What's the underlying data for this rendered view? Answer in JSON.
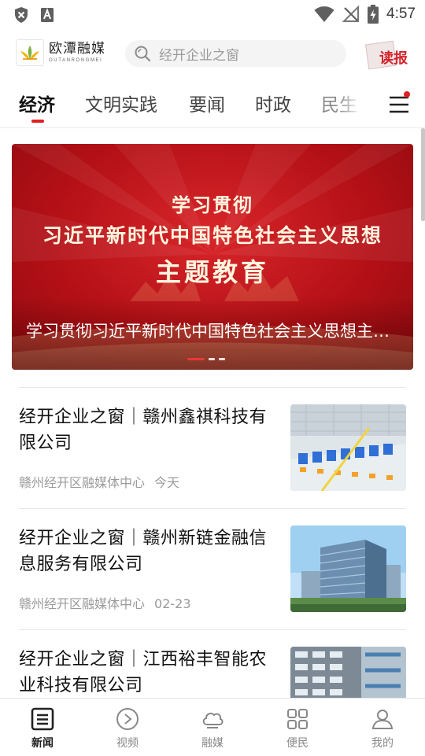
{
  "status_bar": {
    "time": "4:57",
    "icons": [
      "shield-x-icon",
      "font-a-icon",
      "wifi-icon",
      "no-signal-icon",
      "battery-charging-icon"
    ]
  },
  "header": {
    "logo_name": "欧潭融媒",
    "logo_sub": "OUTANRONGMEI",
    "search_placeholder": "经开企业之窗",
    "read_label": "读报"
  },
  "tabs": [
    {
      "label": "经济",
      "active": true
    },
    {
      "label": "文明实践",
      "active": false
    },
    {
      "label": "要闻",
      "active": false
    },
    {
      "label": "时政",
      "active": false
    },
    {
      "label": "民生",
      "active": false
    }
  ],
  "banner": {
    "line1": "学习贯彻",
    "line2": "习近平新时代中国特色社会主义思想",
    "line3": "主题教育",
    "caption": "学习贯彻习近平新时代中国特色社会主义思想主题教育",
    "slide_count": 3,
    "active_slide": 1
  },
  "news": [
    {
      "title": "经开企业之窗｜赣州鑫祺科技有限公司",
      "source": "赣州经开区融媒体中心",
      "date": "今天",
      "thumb": "factory-floor"
    },
    {
      "title": "经开企业之窗｜赣州新链金融信息服务有限公司",
      "source": "赣州经开区融媒体中心",
      "date": "02-23",
      "thumb": "office-building"
    },
    {
      "title": "经开企业之窗｜江西裕丰智能农业科技有限公司",
      "source": "",
      "date": "",
      "thumb": "building-facade"
    }
  ],
  "bottom_nav": [
    {
      "label": "新闻",
      "icon": "news-icon",
      "active": true
    },
    {
      "label": "视频",
      "icon": "video-play-icon",
      "active": false
    },
    {
      "label": "融媒",
      "icon": "cloud-icon",
      "active": false
    },
    {
      "label": "便民",
      "icon": "grid-icon",
      "active": false
    },
    {
      "label": "我的",
      "icon": "user-icon",
      "active": false
    }
  ],
  "colors": {
    "accent": "#e02020",
    "banner_red": "#c0151c",
    "muted": "#9a9a9a"
  }
}
